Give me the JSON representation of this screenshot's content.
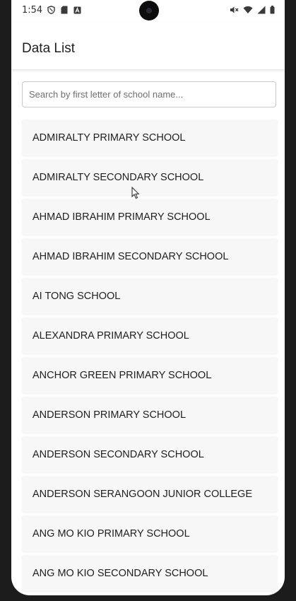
{
  "status_bar": {
    "time": "1:54",
    "left_icons": [
      "shield-icon",
      "sd-card-icon",
      "text-a-icon"
    ],
    "right_icons": [
      "mute-icon",
      "wifi-icon",
      "signal-icon",
      "battery-icon"
    ]
  },
  "app_bar": {
    "title": "Data List"
  },
  "search": {
    "placeholder": "Search by first letter of school name...",
    "value": ""
  },
  "schools": [
    "ADMIRALTY PRIMARY SCHOOL",
    "ADMIRALTY SECONDARY SCHOOL",
    "AHMAD IBRAHIM PRIMARY SCHOOL",
    "AHMAD IBRAHIM SECONDARY SCHOOL",
    "AI TONG SCHOOL",
    "ALEXANDRA PRIMARY SCHOOL",
    "ANCHOR GREEN PRIMARY SCHOOL",
    "ANDERSON PRIMARY SCHOOL",
    "ANDERSON SECONDARY SCHOOL",
    "ANDERSON SERANGOON JUNIOR COLLEGE",
    "ANG MO KIO PRIMARY SCHOOL",
    "ANG MO KIO SECONDARY SCHOOL"
  ]
}
